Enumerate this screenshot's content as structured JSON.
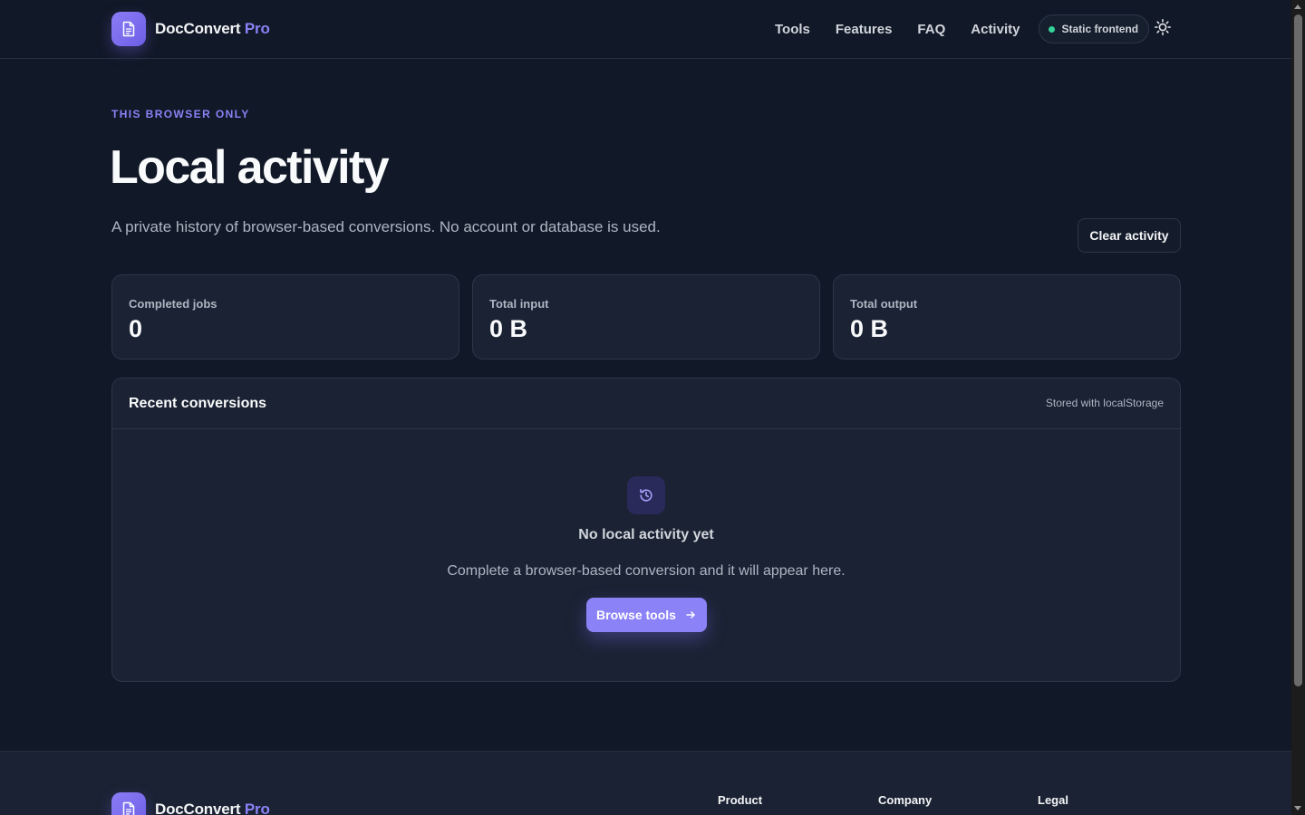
{
  "header": {
    "brand": {
      "name": "DocConvert",
      "suffix": "Pro"
    },
    "nav": [
      {
        "label": "Tools"
      },
      {
        "label": "Features"
      },
      {
        "label": "FAQ"
      },
      {
        "label": "Activity"
      }
    ],
    "status_pill": "Static frontend",
    "icons": {
      "logo": "document-icon",
      "theme": "sun-icon"
    }
  },
  "hero": {
    "eyebrow": "THIS BROWSER ONLY",
    "title": "Local activity",
    "subtitle": "A private history of browser-based conversions. No account or database is used.",
    "clear_label": "Clear activity"
  },
  "stats": [
    {
      "label": "Completed jobs",
      "value": "0"
    },
    {
      "label": "Total input",
      "value": "0 B"
    },
    {
      "label": "Total output",
      "value": "0 B"
    }
  ],
  "recent": {
    "title": "Recent conversions",
    "note": "Stored with localStorage",
    "empty_icon": "history-icon",
    "empty_title": "No local activity yet",
    "empty_text": "Complete a browser-based conversion and it will appear here.",
    "browse_label": "Browse tools"
  },
  "footer": {
    "brand": {
      "name": "DocConvert",
      "suffix": "Pro"
    },
    "columns": [
      {
        "heading": "Product"
      },
      {
        "heading": "Company"
      },
      {
        "heading": "Legal"
      }
    ]
  },
  "colors": {
    "background": "#111827",
    "surface": "#1a2233",
    "accent": "#8b82f7",
    "status_dot": "#34d399"
  }
}
